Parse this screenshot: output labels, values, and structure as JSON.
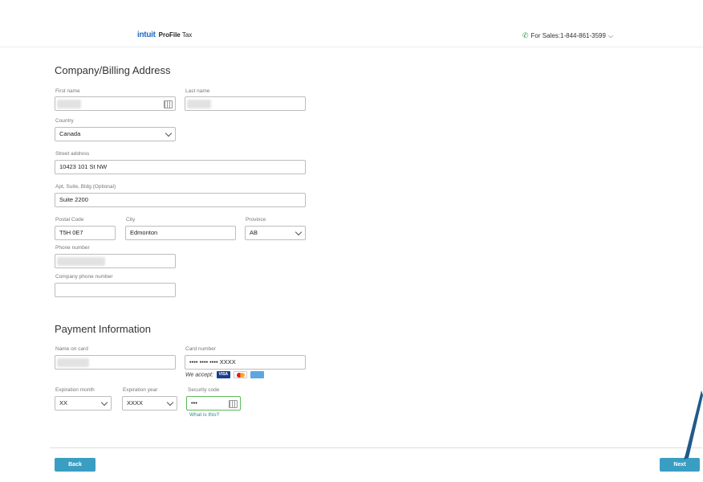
{
  "header": {
    "logo_intuit": "intuit",
    "logo_product": "ProFile",
    "logo_suffix": "Tax",
    "sales_label": "For Sales:1-844-861-3599"
  },
  "billing": {
    "title": "Company/Billing Address",
    "first_name_label": "First name",
    "first_name_value": "",
    "last_name_label": "Last name",
    "last_name_value": "",
    "country_label": "Country",
    "country_value": "Canada",
    "street_label": "Street address",
    "street_value": "10423 101 St NW",
    "apt_label": "Apt, Suite, Bldg (Optional)",
    "apt_value": "Suite 2200",
    "postal_label": "Postal Code",
    "postal_value": "T5H 0E7",
    "city_label": "City",
    "city_value": "Edmonton",
    "province_label": "Province",
    "province_value": "AB",
    "phone_label": "Phone number",
    "phone_value": "",
    "company_phone_label": "Company phone number",
    "company_phone_value": ""
  },
  "payment": {
    "title": "Payment Information",
    "name_label": "Name on card",
    "name_value": "",
    "card_label": "Card number",
    "card_value": "•••• •••• •••• XXXX",
    "we_accept": "We accept:",
    "cards": [
      "VISA",
      "MC",
      "AMEX"
    ],
    "exp_month_label": "Expiration month",
    "exp_month_value": "XX",
    "exp_year_label": "Expiration year",
    "exp_year_value": "XXXX",
    "security_label": "Security code",
    "security_value": "•••",
    "what_is_this": "What is this?"
  },
  "footer": {
    "back_label": "Back",
    "next_label": "Next"
  },
  "colors": {
    "button": "#3a9ec2",
    "intuit_blue": "#236cbf",
    "active_border": "#5cb85c",
    "phone_green": "#3a9a3e"
  }
}
